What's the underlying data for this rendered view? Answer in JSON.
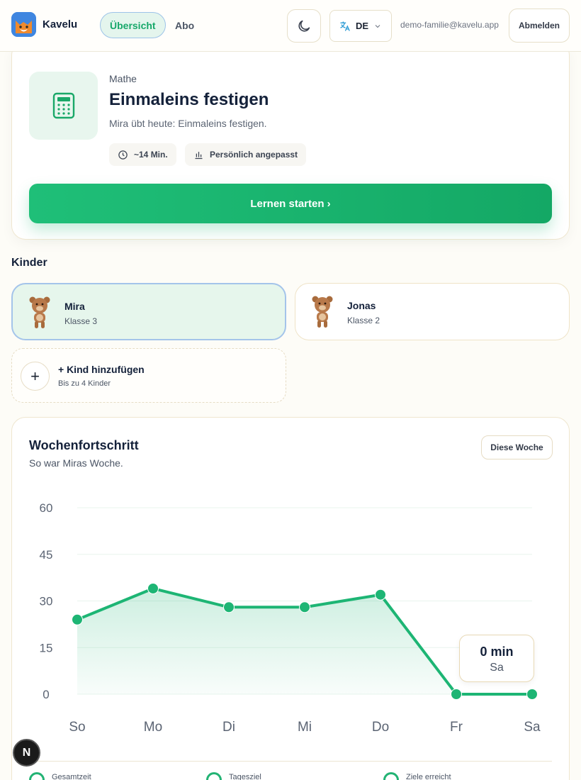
{
  "header": {
    "brand": "Kavelu",
    "nav": [
      {
        "label": "Übersicht",
        "active": true
      },
      {
        "label": "Abo",
        "active": false
      }
    ],
    "theme_icon": "moon-icon",
    "language": {
      "icon": "translate-icon",
      "value": "DE"
    },
    "email": "demo-familie@kavelu.app",
    "logout_label": "Abmelden"
  },
  "lesson": {
    "subject": "Mathe",
    "title": "Einmaleins festigen",
    "description": "Mira übt heute: Einmaleins festigen.",
    "icon": "calculator-icon",
    "chips": [
      {
        "icon": "clock-icon",
        "label": "~14 Min."
      },
      {
        "icon": "bar-chart-icon",
        "label": "Persönlich angepasst"
      }
    ],
    "start_label": "Lernen starten ›"
  },
  "children": {
    "title": "Kinder",
    "items": [
      {
        "name": "Mira",
        "grade": "Klasse 3",
        "selected": true
      },
      {
        "name": "Jonas",
        "grade": "Klasse 2",
        "selected": false
      }
    ],
    "add": {
      "title": "+ Kind hinzufügen",
      "subtitle": "Bis zu 4 Kinder"
    }
  },
  "progress": {
    "title": "Wochenfortschritt",
    "subtitle": "So war Miras Woche.",
    "range_label": "Diese Woche",
    "tooltip": {
      "value": "0 min",
      "day": "Sa"
    },
    "stats": [
      "Gesamtzeit",
      "Tagesziel",
      "Ziele erreicht"
    ]
  },
  "chart_data": {
    "type": "area",
    "categories": [
      "So",
      "Mo",
      "Di",
      "Mi",
      "Do",
      "Fr",
      "Sa"
    ],
    "series": [
      {
        "values": [
          24,
          34,
          28,
          28,
          32,
          0,
          0
        ]
      }
    ],
    "yticks": [
      60,
      45,
      30,
      15,
      0
    ],
    "ylim": [
      0,
      60
    ],
    "grid": true,
    "color": "#1db574"
  },
  "colors": {
    "accent": "#1db574",
    "selected_border": "#a4c4ea",
    "page_bg": "#fdfcf7"
  },
  "badge": {
    "label": "N"
  }
}
